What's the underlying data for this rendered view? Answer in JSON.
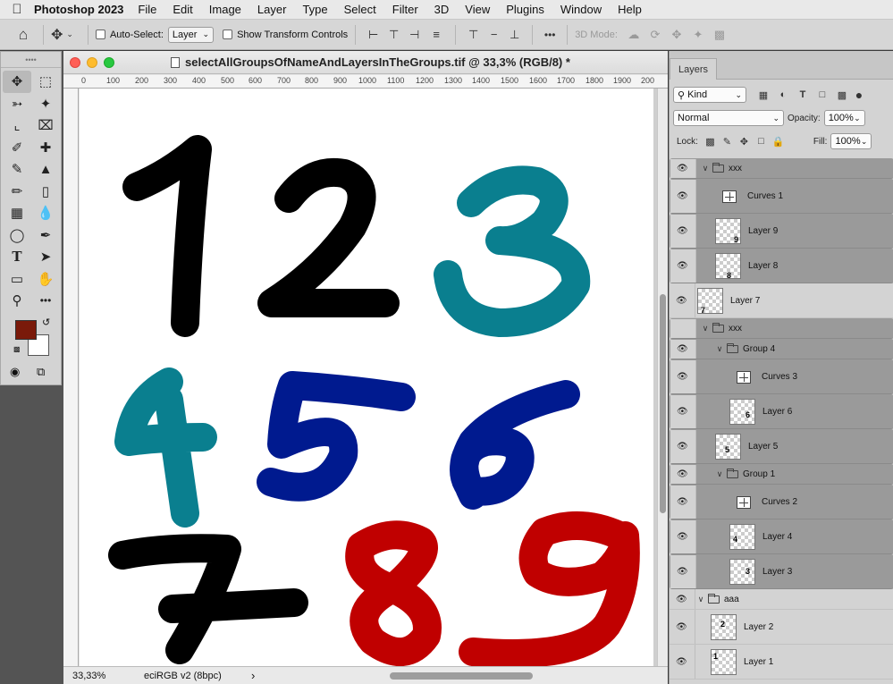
{
  "menubar": {
    "app_name": "Photoshop 2023",
    "items": [
      "File",
      "Edit",
      "Image",
      "Layer",
      "Type",
      "Select",
      "Filter",
      "3D",
      "View",
      "Plugins",
      "Window",
      "Help"
    ]
  },
  "options_bar": {
    "auto_select_label": "Auto-Select:",
    "auto_select_value": "Layer",
    "show_transform_label": "Show Transform Controls",
    "mode_3d_label": "3D Mode:",
    "more_glyph": "•••"
  },
  "document": {
    "title": "selectAllGroupsOfNameAndLayersInTheGroups.tif @ 33,3% (RGB/8) *",
    "ruler_labels": [
      "0",
      "100",
      "200",
      "300",
      "400",
      "500",
      "600",
      "700",
      "800",
      "900",
      "1000",
      "1100",
      "1200",
      "1300",
      "1400",
      "1500",
      "1600",
      "1700",
      "1800",
      "1900",
      "200"
    ],
    "zoom": "33,33%",
    "profile": "eciRGB v2 (8bpc)",
    "status_arrow": "›",
    "digits": [
      {
        "char": "1",
        "color": "#000000"
      },
      {
        "char": "2",
        "color": "#000000"
      },
      {
        "char": "3",
        "color": "#0a7f8f"
      },
      {
        "char": "4",
        "color": "#0a7f8f"
      },
      {
        "char": "5",
        "color": "#001a8f"
      },
      {
        "char": "6",
        "color": "#001a8f"
      },
      {
        "char": "7",
        "color": "#000000"
      },
      {
        "char": "8",
        "color": "#c00000"
      },
      {
        "char": "9",
        "color": "#c00000"
      }
    ]
  },
  "tools": {
    "foreground_color": "#7a1a0a",
    "background_color": "#ffffff"
  },
  "layers_panel": {
    "tab_label": "Layers",
    "filter_kind": "Kind",
    "blend_mode": "Normal",
    "opacity_label": "Opacity:",
    "opacity_value": "100%",
    "lock_label": "Lock:",
    "fill_label": "Fill:",
    "fill_value": "100%",
    "layers": [
      {
        "name": "xxx",
        "type": "group",
        "indent": 0,
        "selected": true,
        "visible": true
      },
      {
        "name": "Curves 1",
        "type": "adjustment",
        "indent": 1,
        "selected": true,
        "visible": true
      },
      {
        "name": "Layer 9",
        "type": "pixel",
        "indent": 1,
        "selected": true,
        "visible": true,
        "thumb": "9"
      },
      {
        "name": "Layer 8",
        "type": "pixel",
        "indent": 1,
        "selected": true,
        "visible": true,
        "thumb": "8"
      },
      {
        "name": "Layer 7",
        "type": "pixel",
        "indent": 0,
        "selected": false,
        "visible": true,
        "thumb": "7"
      },
      {
        "name": "xxx",
        "type": "group",
        "indent": 0,
        "selected": true,
        "visible": false
      },
      {
        "name": "Group 4",
        "type": "group",
        "indent": 1,
        "selected": true,
        "visible": true
      },
      {
        "name": "Curves 3",
        "type": "adjustment",
        "indent": 2,
        "selected": true,
        "visible": true
      },
      {
        "name": "Layer 6",
        "type": "pixel",
        "indent": 2,
        "selected": true,
        "visible": true,
        "thumb": "6"
      },
      {
        "name": "Layer 5",
        "type": "pixel",
        "indent": 1,
        "selected": true,
        "visible": true,
        "thumb": "5"
      },
      {
        "name": "Group 1",
        "type": "group",
        "indent": 1,
        "selected": true,
        "visible": true
      },
      {
        "name": "Curves 2",
        "type": "adjustment",
        "indent": 2,
        "selected": true,
        "visible": true
      },
      {
        "name": "Layer 4",
        "type": "pixel",
        "indent": 2,
        "selected": true,
        "visible": true,
        "thumb": "4"
      },
      {
        "name": "Layer 3",
        "type": "pixel",
        "indent": 2,
        "selected": true,
        "visible": true,
        "thumb": "3"
      },
      {
        "name": "aaa",
        "type": "group",
        "indent": 0,
        "selected": false,
        "visible": true
      },
      {
        "name": "Layer 2",
        "type": "pixel",
        "indent": 1,
        "selected": false,
        "visible": true,
        "thumb": "2"
      },
      {
        "name": "Layer 1",
        "type": "pixel",
        "indent": 1,
        "selected": false,
        "visible": true,
        "thumb": "1"
      }
    ]
  }
}
